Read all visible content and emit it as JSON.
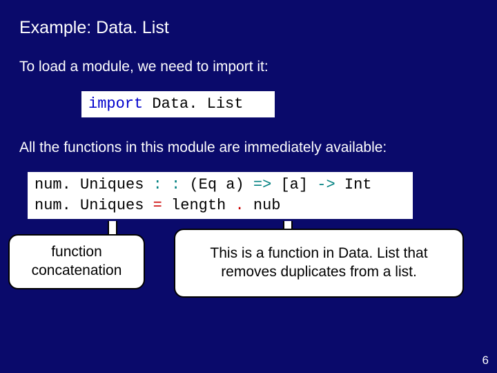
{
  "title": "Example: Data. List",
  "intro": "To load a module, we need to import it:",
  "importLine": {
    "kw": "import",
    "mod": " Data. List"
  },
  "afterImport": "All the functions in this module are immediately available:",
  "code": {
    "line1": {
      "name": "num. Uniques ",
      "dcolon": ": :",
      "constraint": " (Eq a) ",
      "arrow1": "=>",
      "list": " [a] ",
      "arrow2": "->",
      "ret": " Int"
    },
    "line2": {
      "name": "num. Uniques ",
      "eq": "=",
      "length": " length ",
      "dot": ".",
      "nub": " nub"
    }
  },
  "callouts": {
    "left": "function concatenation",
    "right": "This is a function in Data. List that removes duplicates from a list."
  },
  "pageNumber": "6"
}
